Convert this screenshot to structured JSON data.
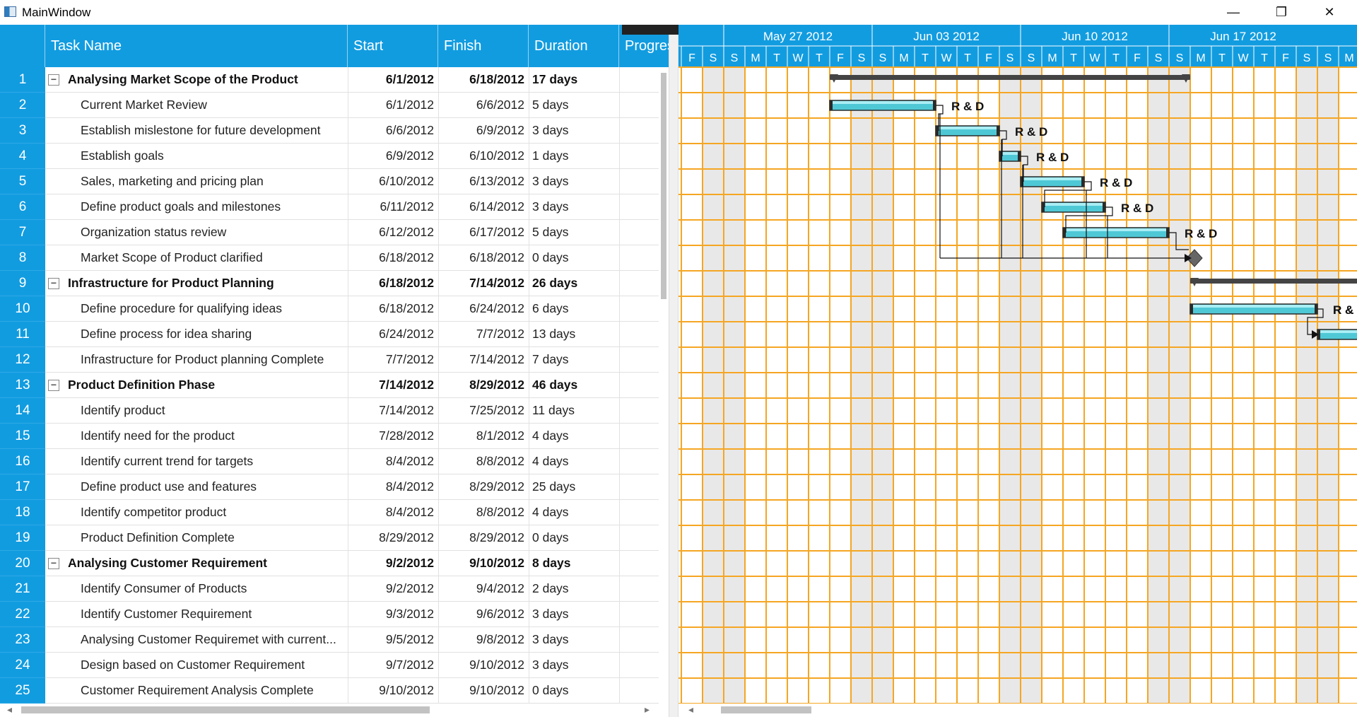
{
  "window": {
    "title": "MainWindow"
  },
  "grid": {
    "columns": {
      "task": "Task Name",
      "start": "Start",
      "finish": "Finish",
      "duration": "Duration",
      "progress": "Progress"
    },
    "rows": [
      {
        "id": "1",
        "name": "Analysing Market Scope of the Product",
        "start": "6/1/2012",
        "finish": "6/18/2012",
        "duration": "17 days",
        "parent": true,
        "expander": "−"
      },
      {
        "id": "2",
        "name": "Current Market Review",
        "start": "6/1/2012",
        "finish": "6/6/2012",
        "duration": "5 days",
        "parent": false
      },
      {
        "id": "3",
        "name": "Establish mislestone for future development",
        "start": "6/6/2012",
        "finish": "6/9/2012",
        "duration": "3 days",
        "parent": false
      },
      {
        "id": "4",
        "name": "Establish goals",
        "start": "6/9/2012",
        "finish": "6/10/2012",
        "duration": "1 days",
        "parent": false
      },
      {
        "id": "5",
        "name": "Sales, marketing and pricing plan",
        "start": "6/10/2012",
        "finish": "6/13/2012",
        "duration": "3 days",
        "parent": false
      },
      {
        "id": "6",
        "name": "Define product goals and milestones",
        "start": "6/11/2012",
        "finish": "6/14/2012",
        "duration": "3 days",
        "parent": false
      },
      {
        "id": "7",
        "name": "Organization status review",
        "start": "6/12/2012",
        "finish": "6/17/2012",
        "duration": "5 days",
        "parent": false
      },
      {
        "id": "8",
        "name": "Market Scope of Product clarified",
        "start": "6/18/2012",
        "finish": "6/18/2012",
        "duration": "0 days",
        "parent": false
      },
      {
        "id": "9",
        "name": "Infrastructure for Product Planning",
        "start": "6/18/2012",
        "finish": "7/14/2012",
        "duration": "26 days",
        "parent": true,
        "expander": "−"
      },
      {
        "id": "10",
        "name": "Define procedure for qualifying ideas",
        "start": "6/18/2012",
        "finish": "6/24/2012",
        "duration": "6 days",
        "parent": false
      },
      {
        "id": "11",
        "name": "Define process for idea sharing",
        "start": "6/24/2012",
        "finish": "7/7/2012",
        "duration": "13 days",
        "parent": false
      },
      {
        "id": "12",
        "name": "Infrastructure for Product planning Complete",
        "start": "7/7/2012",
        "finish": "7/14/2012",
        "duration": "7 days",
        "parent": false
      },
      {
        "id": "13",
        "name": "Product Definition Phase",
        "start": "7/14/2012",
        "finish": "8/29/2012",
        "duration": "46 days",
        "parent": true,
        "expander": "−"
      },
      {
        "id": "14",
        "name": "Identify product",
        "start": "7/14/2012",
        "finish": "7/25/2012",
        "duration": "11 days",
        "parent": false
      },
      {
        "id": "15",
        "name": "Identify need for the product",
        "start": "7/28/2012",
        "finish": "8/1/2012",
        "duration": "4 days",
        "parent": false
      },
      {
        "id": "16",
        "name": "Identify current trend for targets",
        "start": "8/4/2012",
        "finish": "8/8/2012",
        "duration": "4 days",
        "parent": false
      },
      {
        "id": "17",
        "name": "Define product use and features",
        "start": "8/4/2012",
        "finish": "8/29/2012",
        "duration": "25 days",
        "parent": false
      },
      {
        "id": "18",
        "name": "Identify competitor product",
        "start": "8/4/2012",
        "finish": "8/8/2012",
        "duration": "4 days",
        "parent": false
      },
      {
        "id": "19",
        "name": "Product Definition Complete",
        "start": "8/29/2012",
        "finish": "8/29/2012",
        "duration": "0 days",
        "parent": false
      },
      {
        "id": "20",
        "name": "Analysing Customer Requirement",
        "start": "9/2/2012",
        "finish": "9/10/2012",
        "duration": "8 days",
        "parent": true,
        "expander": "−"
      },
      {
        "id": "21",
        "name": "Identify Consumer of Products",
        "start": "9/2/2012",
        "finish": "9/4/2012",
        "duration": "2 days",
        "parent": false
      },
      {
        "id": "22",
        "name": "Identify Customer Requirement",
        "start": "9/3/2012",
        "finish": "9/6/2012",
        "duration": "3 days",
        "parent": false
      },
      {
        "id": "23",
        "name": "Analysing Customer Requiremet with current...",
        "start": "9/5/2012",
        "finish": "9/8/2012",
        "duration": "3 days",
        "parent": false
      },
      {
        "id": "24",
        "name": "Design based on Customer Requirement",
        "start": "9/7/2012",
        "finish": "9/10/2012",
        "duration": "3 days",
        "parent": false
      },
      {
        "id": "25",
        "name": "Customer Requirement Analysis Complete",
        "start": "9/10/2012",
        "finish": "9/10/2012",
        "duration": "0 days",
        "parent": false
      }
    ]
  },
  "chart": {
    "weeks": [
      "May 27 2012",
      "Jun 03 2012",
      "Jun 10 2012",
      "Jun 17 2012"
    ],
    "day_letters": [
      "F",
      "S",
      "S",
      "M",
      "T",
      "W",
      "T",
      "F",
      "S",
      "S",
      "M",
      "T",
      "W",
      "T",
      "F",
      "S",
      "S",
      "M",
      "T",
      "W",
      "T",
      "F",
      "S",
      "S",
      "M",
      "T",
      "W",
      "T",
      "F",
      "S",
      "S",
      "M"
    ],
    "first_day": 0,
    "bars": [
      {
        "row": 0,
        "type": "summary",
        "start": 7,
        "end": 24
      },
      {
        "row": 1,
        "type": "task",
        "start": 7,
        "end": 12,
        "label": "R & D"
      },
      {
        "row": 2,
        "type": "task",
        "start": 12,
        "end": 15,
        "label": "R & D"
      },
      {
        "row": 3,
        "type": "task",
        "start": 15,
        "end": 16,
        "label": "R & D"
      },
      {
        "row": 4,
        "type": "task",
        "start": 16,
        "end": 19,
        "label": "R & D"
      },
      {
        "row": 5,
        "type": "task",
        "start": 17,
        "end": 20,
        "label": "R & D"
      },
      {
        "row": 6,
        "type": "task",
        "start": 18,
        "end": 23,
        "label": "R & D"
      },
      {
        "row": 7,
        "type": "milestone",
        "start": 24,
        "end": 24
      },
      {
        "row": 8,
        "type": "summary",
        "start": 24,
        "end": 50
      },
      {
        "row": 9,
        "type": "task",
        "start": 24,
        "end": 30,
        "label": "R & D"
      },
      {
        "row": 10,
        "type": "task",
        "start": 30,
        "end": 43,
        "label": ""
      }
    ],
    "colors": {
      "header": "#129ce0",
      "grid": "#f5a623",
      "weekend": "#e8e8e8",
      "bar": "#4fc8d6",
      "summary": "#444444"
    }
  },
  "scroll": {
    "left_arrow": "◂",
    "right_arrow": "▸",
    "down_arrow": "▾",
    "up_arrow": "▴"
  }
}
